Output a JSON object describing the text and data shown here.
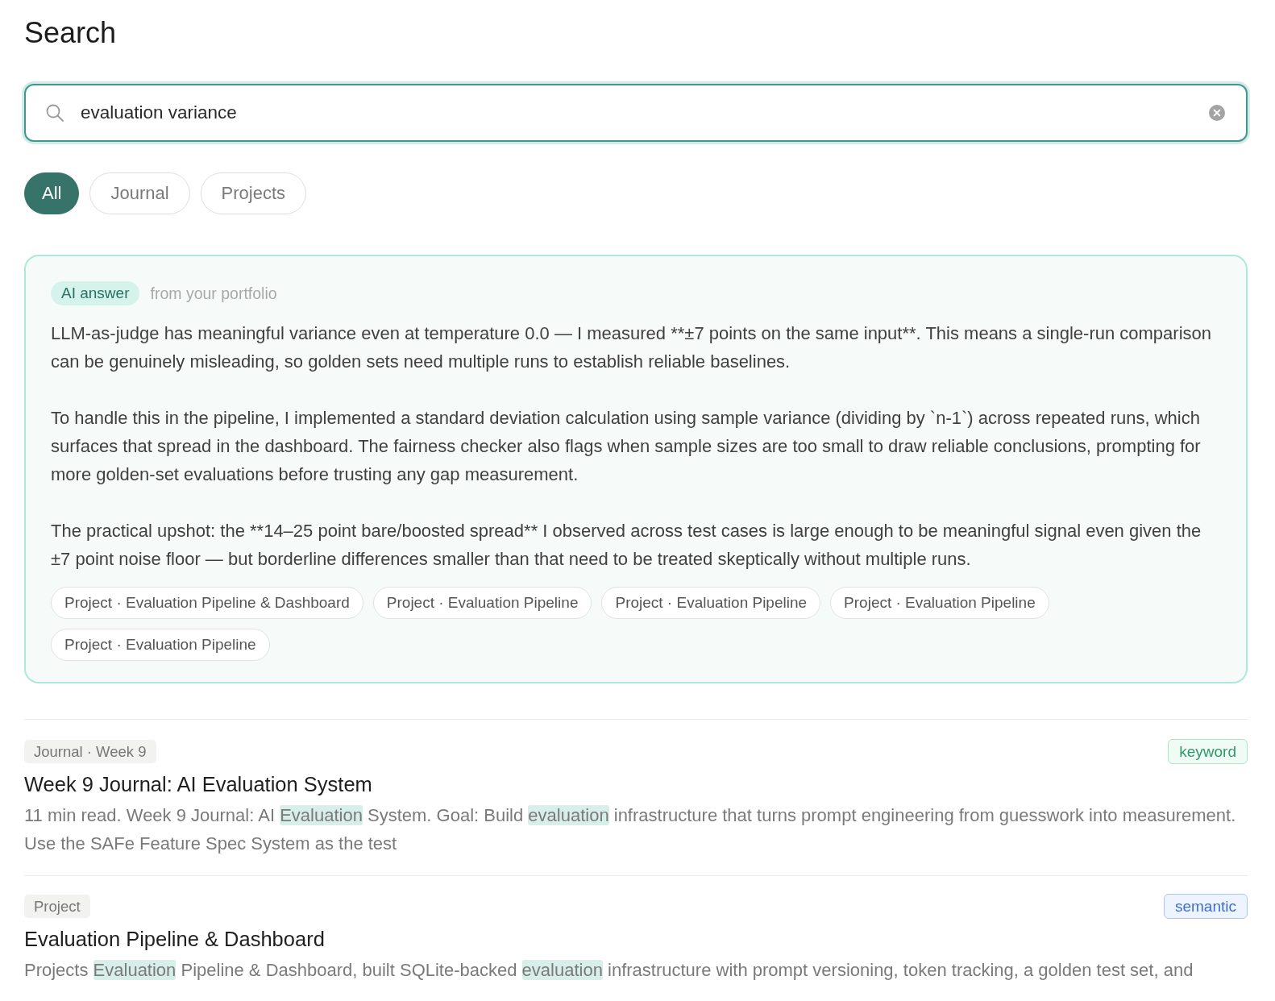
{
  "page": {
    "title": "Search"
  },
  "search": {
    "value": "evaluation variance"
  },
  "filters": [
    {
      "label": "All",
      "selected": true
    },
    {
      "label": "Journal",
      "selected": false
    },
    {
      "label": "Projects",
      "selected": false
    }
  ],
  "ai_answer": {
    "badge": "AI answer",
    "source_note": "from your portfolio",
    "paragraphs": [
      "LLM-as-judge has meaningful variance even at temperature 0.0 — I measured **±7 points on the same input**. This means a single-run comparison can be genuinely misleading, so golden sets need multiple runs to establish reliable baselines.",
      "To handle this in the pipeline, I implemented a standard deviation calculation using sample variance (dividing by `n-1`) across repeated runs, which surfaces that spread in the dashboard. The fairness checker also flags when sample sizes are too small to draw reliable conclusions, prompting for more golden-set evaluations before trusting any gap measurement.",
      "The practical upshot: the **14–25 point bare/boosted spread** I observed across test cases is large enough to be meaningful signal even given the ±7 point noise floor — but borderline differences smaller than that need to be treated skeptically without multiple runs."
    ],
    "sources": [
      "Project · Evaluation Pipeline & Dashboard",
      "Project · Evaluation Pipeline",
      "Project · Evaluation Pipeline",
      "Project · Evaluation Pipeline",
      "Project · Evaluation Pipeline"
    ]
  },
  "results": [
    {
      "tag": "Journal · Week 9",
      "match": {
        "label": "keyword",
        "kind": "keyword"
      },
      "title": "Week 9 Journal: AI Evaluation System",
      "snippet": [
        {
          "text": "11 min read. Week 9 Journal: AI ",
          "highlighted": false
        },
        {
          "text": "Evaluation",
          "highlighted": true
        },
        {
          "text": " System. Goal: Build ",
          "highlighted": false
        },
        {
          "text": "evaluation",
          "highlighted": true
        },
        {
          "text": " infrastructure that turns prompt engineering from guesswork into measurement. Use the SAFe Feature Spec System as the test",
          "highlighted": false
        }
      ]
    },
    {
      "tag": "Project",
      "match": {
        "label": "semantic",
        "kind": "semantic"
      },
      "title": "Evaluation Pipeline & Dashboard",
      "snippet": [
        {
          "text": "Projects ",
          "highlighted": false
        },
        {
          "text": "Evaluation",
          "highlighted": true
        },
        {
          "text": " Pipeline & Dashboard, built SQLite-backed ",
          "highlighted": false
        },
        {
          "text": "evaluation",
          "highlighted": true
        },
        {
          "text": " infrastructure with prompt versioning, token tracking, a golden test set, and",
          "highlighted": false
        }
      ]
    }
  ]
}
